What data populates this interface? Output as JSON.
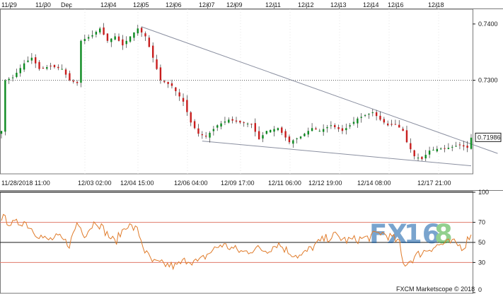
{
  "chart_data": [
    {
      "type": "candlestick",
      "instrument_axis": "price",
      "top_date_labels": [
        "11/29",
        "11/30",
        "Dec",
        "12/04",
        "12/05",
        "12/06",
        "12/07",
        "12/09",
        "12/11",
        "12/12",
        "12/13",
        "12/14",
        "12/16",
        "12/18"
      ],
      "bottom_time_labels": [
        "11/28/2018 11:00",
        "12/03 02:00",
        "12/04 15:00",
        "12/06 04:00",
        "12/09 17:00",
        "12/11 06:00",
        "12/12 19:00",
        "12/14 08:00",
        "12/17 21:00"
      ],
      "y_ticks": [
        "0.7400",
        "0.7300"
      ],
      "ylim": [
        0.7135,
        0.7425
      ],
      "last_price": "0.71986",
      "last_price_value": 0.71986,
      "reference_line": 0.73,
      "colors": {
        "up": "#0c8a20",
        "down": "#c81e1e",
        "wick": "#333333",
        "trendline": "#8a8fa0",
        "last_box": "#1a1a1a"
      },
      "anchors": [
        [
          0,
          0.721
        ],
        [
          1,
          0.73
        ],
        [
          3,
          0.7305
        ],
        [
          6,
          0.733
        ],
        [
          8,
          0.734
        ],
        [
          10,
          0.732
        ],
        [
          13,
          0.7325
        ],
        [
          16,
          0.732
        ],
        [
          18,
          0.73
        ],
        [
          20,
          0.7295
        ],
        [
          21,
          0.737
        ],
        [
          24,
          0.738
        ],
        [
          26,
          0.7392
        ],
        [
          28,
          0.737
        ],
        [
          30,
          0.7378
        ],
        [
          32,
          0.7362
        ],
        [
          34,
          0.7378
        ],
        [
          36,
          0.7392
        ],
        [
          38,
          0.7378
        ],
        [
          40,
          0.734
        ],
        [
          42,
          0.73
        ],
        [
          45,
          0.729
        ],
        [
          48,
          0.7262
        ],
        [
          50,
          0.7225
        ],
        [
          52,
          0.7205
        ],
        [
          54,
          0.72
        ],
        [
          57,
          0.722
        ],
        [
          60,
          0.723
        ],
        [
          63,
          0.7225
        ],
        [
          66,
          0.7222
        ],
        [
          68,
          0.7195
        ],
        [
          70,
          0.721
        ],
        [
          73,
          0.7215
        ],
        [
          76,
          0.719
        ],
        [
          79,
          0.72
        ],
        [
          82,
          0.7215
        ],
        [
          84,
          0.721
        ],
        [
          87,
          0.722
        ],
        [
          90,
          0.721
        ],
        [
          92,
          0.722
        ],
        [
          94,
          0.7232
        ],
        [
          96,
          0.7238
        ],
        [
          98,
          0.7243
        ],
        [
          100,
          0.723
        ],
        [
          102,
          0.722
        ],
        [
          104,
          0.7222
        ],
        [
          106,
          0.721
        ],
        [
          107,
          0.719
        ],
        [
          109,
          0.7165
        ],
        [
          111,
          0.716
        ],
        [
          113,
          0.7175
        ],
        [
          115,
          0.7178
        ],
        [
          118,
          0.718
        ],
        [
          121,
          0.7185
        ],
        [
          123,
          0.718
        ],
        [
          124,
          0.7198
        ]
      ],
      "trendlines": [
        {
          "from": [
            37,
            0.7395
          ],
          "to": [
            131,
            0.717
          ]
        },
        {
          "from": [
            53,
            0.7192
          ],
          "to": [
            124,
            0.7148
          ]
        }
      ]
    },
    {
      "type": "line",
      "indicator": "oscillator",
      "y_ticks": [
        "100",
        "70",
        "50",
        "30",
        "0"
      ],
      "ylim": [
        0,
        100
      ],
      "levels": [
        {
          "value": 100,
          "color": "#1a1a1a"
        },
        {
          "value": 70,
          "color": "#e07a6a"
        },
        {
          "value": 50,
          "color": "#1a1a1a"
        },
        {
          "value": 30,
          "color": "#e07a6a"
        }
      ],
      "line_color": "#e07b2a",
      "anchors": [
        [
          0,
          75
        ],
        [
          3,
          68
        ],
        [
          6,
          71
        ],
        [
          9,
          60
        ],
        [
          12,
          52
        ],
        [
          15,
          55
        ],
        [
          18,
          48
        ],
        [
          20,
          70
        ],
        [
          22,
          58
        ],
        [
          25,
          72
        ],
        [
          28,
          58
        ],
        [
          30,
          50
        ],
        [
          33,
          68
        ],
        [
          36,
          62
        ],
        [
          38,
          40
        ],
        [
          40,
          30
        ],
        [
          43,
          28
        ],
        [
          46,
          26
        ],
        [
          49,
          33
        ],
        [
          52,
          30
        ],
        [
          55,
          40
        ],
        [
          58,
          48
        ],
        [
          61,
          44
        ],
        [
          64,
          40
        ],
        [
          67,
          44
        ],
        [
          70,
          42
        ],
        [
          73,
          49
        ],
        [
          76,
          40
        ],
        [
          79,
          36
        ],
        [
          82,
          45
        ],
        [
          85,
          53
        ],
        [
          88,
          57
        ],
        [
          91,
          52
        ],
        [
          94,
          53
        ],
        [
          97,
          55
        ],
        [
          100,
          60
        ],
        [
          103,
          55
        ],
        [
          105,
          50
        ],
        [
          106,
          28
        ],
        [
          108,
          32
        ],
        [
          110,
          38
        ],
        [
          113,
          44
        ],
        [
          116,
          48
        ],
        [
          119,
          50
        ],
        [
          122,
          45
        ],
        [
          124,
          60
        ]
      ]
    }
  ],
  "watermark": {
    "part1": "FX",
    "part2": "16",
    "part3": "8",
    "color1": "#0d5aa7",
    "color2": "#3aaa35"
  },
  "copyright": "FXCM Marketscope © 2018"
}
